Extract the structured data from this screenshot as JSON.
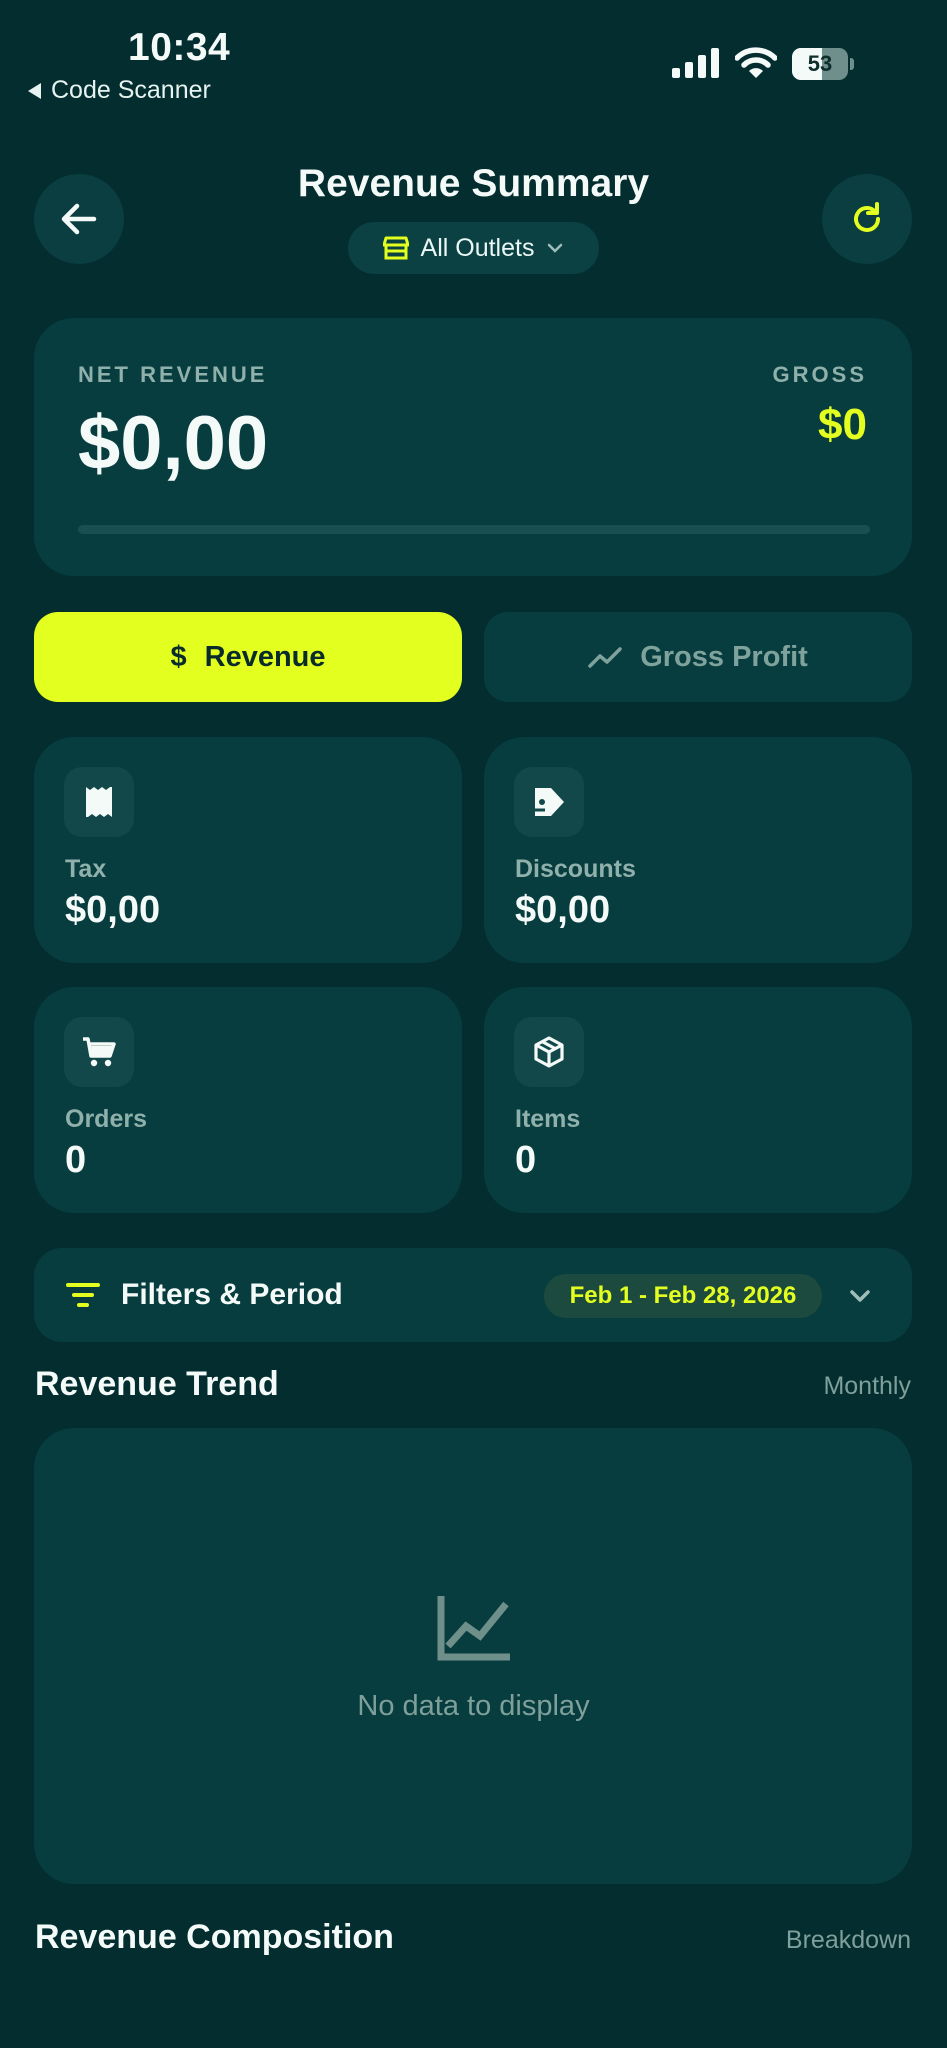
{
  "status_bar": {
    "time": "10:34",
    "back_app": "Code Scanner",
    "battery_level": "53",
    "battery_fraction": 0.53
  },
  "header": {
    "title": "Revenue Summary",
    "outlet_selector": "All Outlets"
  },
  "net_revenue": {
    "label": "NET REVENUE",
    "value": "$0,00",
    "gross_label": "GROSS",
    "gross_value": "$0",
    "progress_fraction": 0
  },
  "toggle": {
    "revenue_label": "Revenue",
    "revenue_symbol": "$",
    "gross_profit_label": "Gross Profit",
    "selected": "revenue"
  },
  "stats": [
    {
      "label": "Tax",
      "value": "$0,00",
      "icon": "receipt-icon"
    },
    {
      "label": "Discounts",
      "value": "$0,00",
      "icon": "tag-icon"
    },
    {
      "label": "Orders",
      "value": "0",
      "icon": "cart-icon"
    },
    {
      "label": "Items",
      "value": "0",
      "icon": "box-icon"
    }
  ],
  "filters": {
    "label": "Filters & Period",
    "date_range": "Feb 1 - Feb 28, 2026"
  },
  "trend": {
    "title": "Revenue Trend",
    "period": "Monthly",
    "empty_text": "No data to display"
  },
  "composition": {
    "title": "Revenue Composition",
    "note": "Breakdown"
  },
  "colors": {
    "background": "#032d2f",
    "card": "#073d3f",
    "accent": "#e3ff1f",
    "muted_text": "#8fb0ab"
  }
}
